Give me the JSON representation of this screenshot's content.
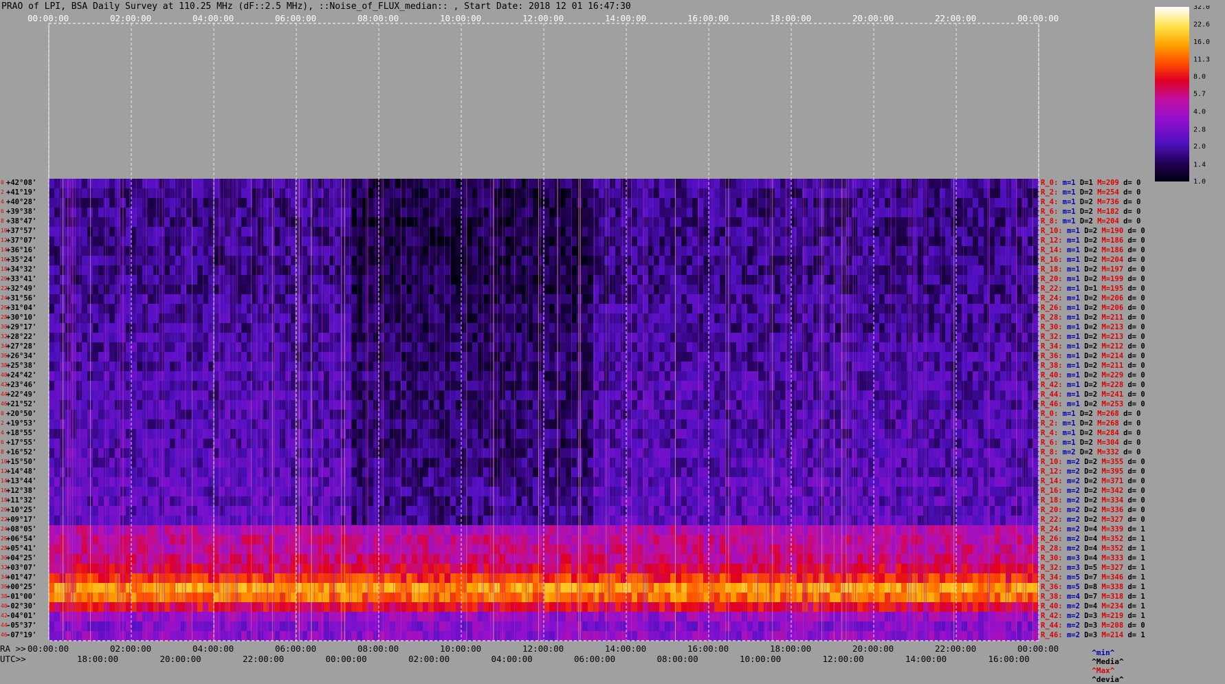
{
  "title": "PRAO of LPI, BSA Daily Survey at 110.25 MHz (dF::2.5 MHz), ::Noise_of_FLUX_median:: , Start Date: 2018 12 01 16:47:30",
  "chart_data": {
    "type": "heatmap",
    "top_axis_ticks": [
      "00:00:00",
      "02:00:00",
      "04:00:00",
      "06:00:00",
      "08:00:00",
      "10:00:00",
      "12:00:00",
      "14:00:00",
      "16:00:00",
      "18:00:00",
      "20:00:00",
      "22:00:00",
      "00:00:00"
    ],
    "bottom_axis_label_1": "RA >>",
    "bottom_axis_ticks_1": [
      "00:00:00",
      "02:00:00",
      "04:00:00",
      "06:00:00",
      "08:00:00",
      "10:00:00",
      "12:00:00",
      "14:00:00",
      "16:00:00",
      "18:00:00",
      "20:00:00",
      "22:00:00",
      "00:00:00"
    ],
    "bottom_axis_label_2": "UTC>>",
    "bottom_axis_ticks_2": [
      "18:00:00",
      "20:00:00",
      "22:00:00",
      "00:00:00",
      "02:00:00",
      "04:00:00",
      "06:00:00",
      "08:00:00",
      "10:00:00",
      "12:00:00",
      "14:00:00",
      "16:00:00"
    ],
    "colorbar_ticks": [
      "32.0",
      "22.6",
      "16.0",
      "11.3",
      "8.0",
      "5.7",
      "4.0",
      "2.8",
      "2.0",
      "1.4",
      "1.0"
    ],
    "colorbar_range": [
      1.0,
      32.0
    ],
    "color_scale": "log",
    "declinations": [
      "+42°08'",
      "+41°19'",
      "+40°28'",
      "+39°38'",
      "+38°47'",
      "+37°57'",
      "+37°07'",
      "+36°16'",
      "+35°24'",
      "+34°32'",
      "+33°41'",
      "+32°49'",
      "+31°56'",
      "+31°04'",
      "+30°10'",
      "+29°17'",
      "+28°22'",
      "+27°28'",
      "+26°34'",
      "+25°38'",
      "+24°42'",
      "+23°46'",
      "+22°49'",
      "+21°52'",
      "+20°50'",
      "+19°53'",
      "+18°55'",
      "+17°55'",
      "+16°52'",
      "+15°50'",
      "+14°48'",
      "+13°44'",
      "+12°38'",
      "+11°32'",
      "+10°25'",
      "+09°17'",
      "+08°05'",
      "+06°54'",
      "+05°41'",
      "+04°25'",
      "+03°07'",
      "+01°47'",
      "+00°25'",
      "-01°00'",
      "-02°30'",
      "-04°01'",
      "-05°37'",
      "-07°19'"
    ],
    "row_indices": [
      "0",
      "2",
      "4",
      "6",
      "8",
      "10",
      "12",
      "14",
      "16",
      "18",
      "20",
      "22",
      "24",
      "26",
      "28",
      "30",
      "32",
      "34",
      "36",
      "38",
      "40",
      "42",
      "44",
      "46",
      "0",
      "2",
      "4",
      "6",
      "8",
      "10",
      "12",
      "14",
      "16",
      "18",
      "20",
      "22",
      "24",
      "26",
      "28",
      "30",
      "32",
      "34",
      "36",
      "38",
      "40",
      "42",
      "44",
      "46"
    ],
    "row_stats": [
      [
        "R_0:",
        "m=1",
        "D=1",
        "M=209",
        "d= 0"
      ],
      [
        "R_2:",
        "m=1",
        "D=2",
        "M=254",
        "d= 0"
      ],
      [
        "R_4:",
        "m=1",
        "D=2",
        "M=736",
        "d= 0"
      ],
      [
        "R_6:",
        "m=1",
        "D=2",
        "M=182",
        "d= 0"
      ],
      [
        "R_8:",
        "m=1",
        "D=2",
        "M=204",
        "d= 0"
      ],
      [
        "R_10:",
        "m=1",
        "D=2",
        "M=190",
        "d= 0"
      ],
      [
        "R_12:",
        "m=1",
        "D=2",
        "M=186",
        "d= 0"
      ],
      [
        "R_14:",
        "m=1",
        "D=2",
        "M=186",
        "d= 0"
      ],
      [
        "R_16:",
        "m=1",
        "D=2",
        "M=204",
        "d= 0"
      ],
      [
        "R_18:",
        "m=1",
        "D=2",
        "M=197",
        "d= 0"
      ],
      [
        "R_20:",
        "m=1",
        "D=2",
        "M=199",
        "d= 0"
      ],
      [
        "R_22:",
        "m=1",
        "D=1",
        "M=195",
        "d= 0"
      ],
      [
        "R_24:",
        "m=1",
        "D=2",
        "M=206",
        "d= 0"
      ],
      [
        "R_26:",
        "m=1",
        "D=2",
        "M=206",
        "d= 0"
      ],
      [
        "R_28:",
        "m=1",
        "D=2",
        "M=211",
        "d= 0"
      ],
      [
        "R_30:",
        "m=1",
        "D=2",
        "M=213",
        "d= 0"
      ],
      [
        "R_32:",
        "m=1",
        "D=2",
        "M=213",
        "d= 0"
      ],
      [
        "R_34:",
        "m=1",
        "D=2",
        "M=212",
        "d= 0"
      ],
      [
        "R_36:",
        "m=1",
        "D=2",
        "M=214",
        "d= 0"
      ],
      [
        "R_38:",
        "m=1",
        "D=2",
        "M=211",
        "d= 0"
      ],
      [
        "R_40:",
        "m=1",
        "D=2",
        "M=229",
        "d= 0"
      ],
      [
        "R_42:",
        "m=1",
        "D=2",
        "M=228",
        "d= 0"
      ],
      [
        "R_44:",
        "m=1",
        "D=2",
        "M=241",
        "d= 0"
      ],
      [
        "R_46:",
        "m=1",
        "D=2",
        "M=253",
        "d= 0"
      ],
      [
        "R_0:",
        "m=1",
        "D=2",
        "M=268",
        "d= 0"
      ],
      [
        "R_2:",
        "m=1",
        "D=2",
        "M=268",
        "d= 0"
      ],
      [
        "R_4:",
        "m=1",
        "D=2",
        "M=284",
        "d= 0"
      ],
      [
        "R_6:",
        "m=1",
        "D=2",
        "M=304",
        "d= 0"
      ],
      [
        "R_8:",
        "m=2",
        "D=2",
        "M=332",
        "d= 0"
      ],
      [
        "R_10:",
        "m=2",
        "D=2",
        "M=355",
        "d= 0"
      ],
      [
        "R_12:",
        "m=2",
        "D=2",
        "M=395",
        "d= 0"
      ],
      [
        "R_14:",
        "m=2",
        "D=2",
        "M=371",
        "d= 0"
      ],
      [
        "R_16:",
        "m=2",
        "D=2",
        "M=342",
        "d= 0"
      ],
      [
        "R_18:",
        "m=2",
        "D=2",
        "M=334",
        "d= 0"
      ],
      [
        "R_20:",
        "m=2",
        "D=2",
        "M=336",
        "d= 0"
      ],
      [
        "R_22:",
        "m=2",
        "D=2",
        "M=327",
        "d= 0"
      ],
      [
        "R_24:",
        "m=2",
        "D=4",
        "M=339",
        "d= 1"
      ],
      [
        "R_26:",
        "m=2",
        "D=4",
        "M=352",
        "d= 1"
      ],
      [
        "R_28:",
        "m=2",
        "D=4",
        "M=352",
        "d= 1"
      ],
      [
        "R_30:",
        "m=3",
        "D=4",
        "M=333",
        "d= 1"
      ],
      [
        "R_32:",
        "m=3",
        "D=5",
        "M=327",
        "d= 1"
      ],
      [
        "R_34:",
        "m=5",
        "D=7",
        "M=346",
        "d= 1"
      ],
      [
        "R_36:",
        "m=5",
        "D=8",
        "M=338",
        "d= 1"
      ],
      [
        "R_38:",
        "m=4",
        "D=7",
        "M=318",
        "d= 1"
      ],
      [
        "R_40:",
        "m=2",
        "D=4",
        "M=234",
        "d= 1"
      ],
      [
        "R_42:",
        "m=2",
        "D=3",
        "M=219",
        "d= 1"
      ],
      [
        "R_44:",
        "m=2",
        "D=3",
        "M=208",
        "d= 0"
      ],
      [
        "R_46:",
        "m=2",
        "D=3",
        "M=214",
        "d= 1"
      ]
    ],
    "legend_min": "^min^",
    "legend_media": "^Media^",
    "legend_max": "^Max^",
    "legend_devia": "^devia^",
    "band_medians": [
      1.7,
      1.6,
      1.6,
      1.6,
      1.6,
      1.6,
      1.6,
      1.6,
      1.6,
      1.6,
      1.6,
      1.6,
      1.7,
      1.7,
      1.7,
      1.7,
      1.8,
      1.8,
      1.8,
      1.8,
      1.9,
      1.9,
      1.9,
      1.9,
      1.9,
      1.9,
      1.9,
      1.9,
      2.0,
      2.0,
      2.0,
      2.1,
      2.1,
      2.1,
      2.1,
      2.1,
      4.5,
      5.0,
      5.0,
      5.5,
      6.5,
      9.0,
      14.0,
      12.0,
      7.0,
      3.5,
      3.0,
      3.2
    ]
  },
  "colors": {
    "background": "#a0a0a0",
    "label_red": "#e00000",
    "label_blue": "#0000b0"
  }
}
